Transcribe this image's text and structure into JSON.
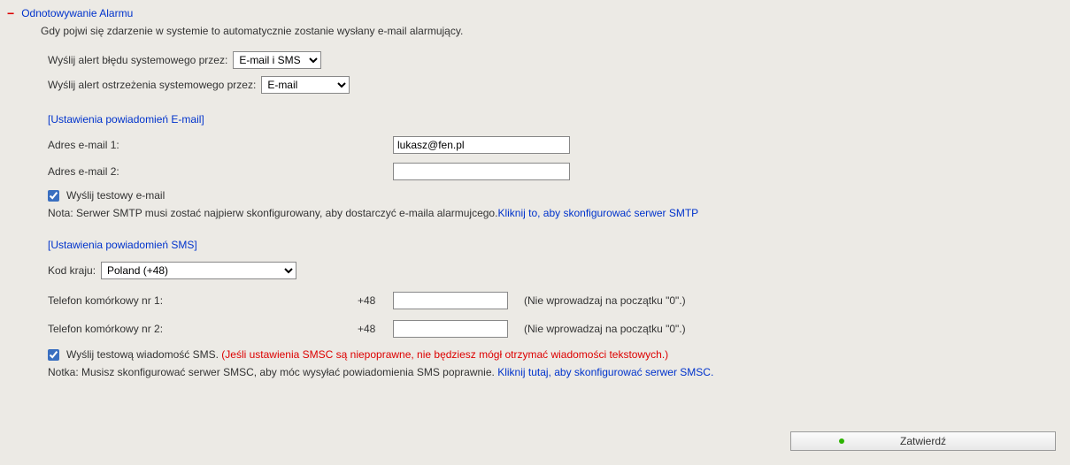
{
  "header": {
    "minus": "−",
    "title": "Odnotowywanie Alarmu"
  },
  "intro": "Gdy pojwi się zdarzenie w systemie to automatycznie zostanie wysłany e-mail alarmujący.",
  "errorAlert": {
    "label": "Wyślij alert błędu systemowego przez:",
    "selected": "E-mail i SMS",
    "options": [
      "E-mail i SMS"
    ]
  },
  "warnAlert": {
    "label": "Wyślij alert ostrzeżenia systemowego przez:",
    "selected": "E-mail",
    "options": [
      "E-mail"
    ]
  },
  "emailSection": {
    "heading": "[Ustawienia powiadomień E-mail]",
    "addr1": {
      "label": "Adres e-mail 1:",
      "value": "lukasz@fen.pl"
    },
    "addr2": {
      "label": "Adres e-mail 2:",
      "value": ""
    },
    "testCheckboxLabel": "Wyślij testowy e-mail",
    "notePrefix": "Nota: Serwer SMTP musi zostać najpierw skonfigurowany, aby dostarczyć e-maila alarmujcego.",
    "noteLink": "Kliknij to, aby skonfigurować serwer SMTP"
  },
  "smsSection": {
    "heading": "[Ustawienia powiadomień SMS]",
    "countryLabel": "Kod kraju:",
    "countrySelected": "Poland (+48)",
    "phone1": {
      "label": "Telefon komórkowy nr 1:",
      "prefix": "+48",
      "value": "",
      "hint": "(Nie wprowadzaj na początku \"0\".)"
    },
    "phone2": {
      "label": "Telefon komórkowy nr 2:",
      "prefix": "+48",
      "value": "",
      "hint": "(Nie wprowadzaj na początku \"0\".)"
    },
    "testCheckboxLabel": "Wyślij testową wiadomość SMS.",
    "testWarn": "(Jeśli ustawienia SMSC są niepoprawne, nie będziesz mógł otrzymać wiadomości tekstowych.)",
    "notePrefix": "Notka: Musisz skonfigurować serwer SMSC, aby móc wysyłać powiadomienia SMS poprawnie. ",
    "noteLink": "Kliknij tutaj, aby skonfigurować serwer SMSC."
  },
  "footer": {
    "submit": "Zatwierdź"
  }
}
